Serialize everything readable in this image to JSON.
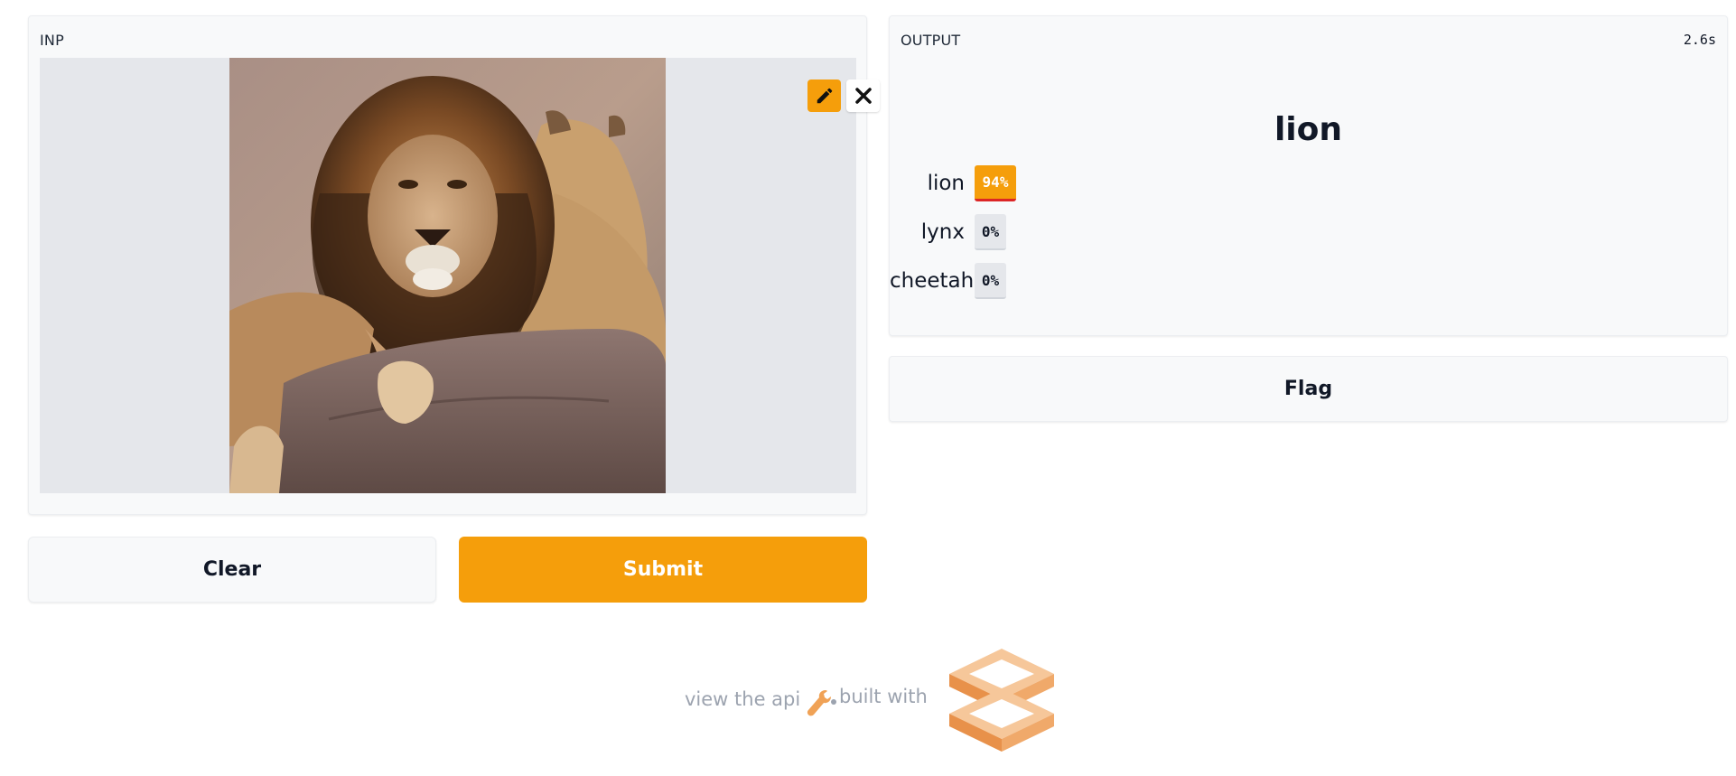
{
  "input": {
    "label": "INP",
    "image_alt": "lion"
  },
  "output": {
    "label": "OUTPUT",
    "timer": "2.6s",
    "prediction": "lion",
    "confidences": [
      {
        "label": "lion",
        "percent": "94%",
        "value": 0.94
      },
      {
        "label": "lynx",
        "percent": "0%",
        "value": 0.0
      },
      {
        "label": "cheetah",
        "percent": "0%",
        "value": 0.0
      }
    ]
  },
  "buttons": {
    "clear": "Clear",
    "submit": "Submit",
    "flag": "Flag"
  },
  "footer": {
    "api_link": "view the api",
    "built_with": "built with"
  },
  "icons": {
    "edit": "pencil-icon",
    "close": "close-icon",
    "api": "wrench-icon",
    "logo": "gradio-logo"
  },
  "colors": {
    "accent": "#f59e0b",
    "panel_bg": "#f8f9fa",
    "image_bg": "#e5e7eb"
  }
}
